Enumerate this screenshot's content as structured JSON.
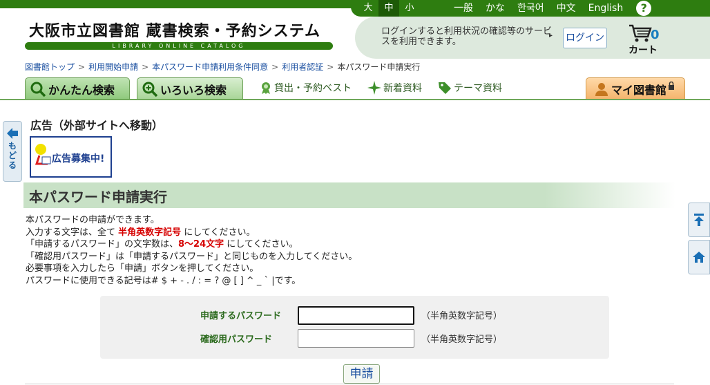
{
  "top": {
    "font_sizes": [
      "大",
      "中",
      "小"
    ],
    "languages": [
      "一般",
      "かな",
      "한국어",
      "中文",
      "English"
    ],
    "help_label": "?"
  },
  "logo": {
    "title": "大阪市立図書館 蔵書検索・予約システム",
    "subtitle": "LIBRARY ONLINE CATALOG"
  },
  "login": {
    "message": "ログインすると利用状況の確認等のサービスを利用できます。",
    "arrow": "▸",
    "button": "ログイン"
  },
  "cart": {
    "count": "0",
    "label": "カート"
  },
  "breadcrumb": [
    "図書館トップ",
    "利用開始申請",
    "本パスワード申請利用条件同意",
    "利用者認証",
    "本パスワード申請実行"
  ],
  "breadcrumb_sep": ">",
  "nav": {
    "easy_search": "かんたん検索",
    "various_search": "いろいろ検索",
    "best": "貸出・予約ベスト",
    "new": "新着資料",
    "theme": "テーマ資料",
    "mylib": "マイ図書館"
  },
  "back_label": "もどる",
  "ad": {
    "title": "広告（外部サイトへ移動）",
    "banner_text": "広告募集中!"
  },
  "heading": "本パスワード申請実行",
  "intro": {
    "line1": "本パスワードの申請ができます。",
    "line2a": "入力する文字は、全て ",
    "line2b": "半角英数字記号",
    "line2c": " にしてください。",
    "line3a": "「申請するパスワード」の文字数は、",
    "line3b": "8～24文字",
    "line3c": " にしてください。",
    "line4": "「確認用パスワード」は「申請するパスワード」と同じものを入力してください。",
    "line5": "必要事項を入力したら「申請」ボタンを押してください。",
    "line6": "パスワードに使用できる記号は# $ + - . / : = ? @ [ ] ^ _ ` |です。"
  },
  "form": {
    "password_label": "申請するパスワード",
    "confirm_label": "確認用パスワード",
    "password_value": "",
    "confirm_value": "",
    "hint": "（半角英数字記号）"
  },
  "submit_label": "申請",
  "colors": {
    "brand_green": "#2e7d10",
    "link_blue": "#1a4fa0",
    "alert_red": "#d60000"
  }
}
